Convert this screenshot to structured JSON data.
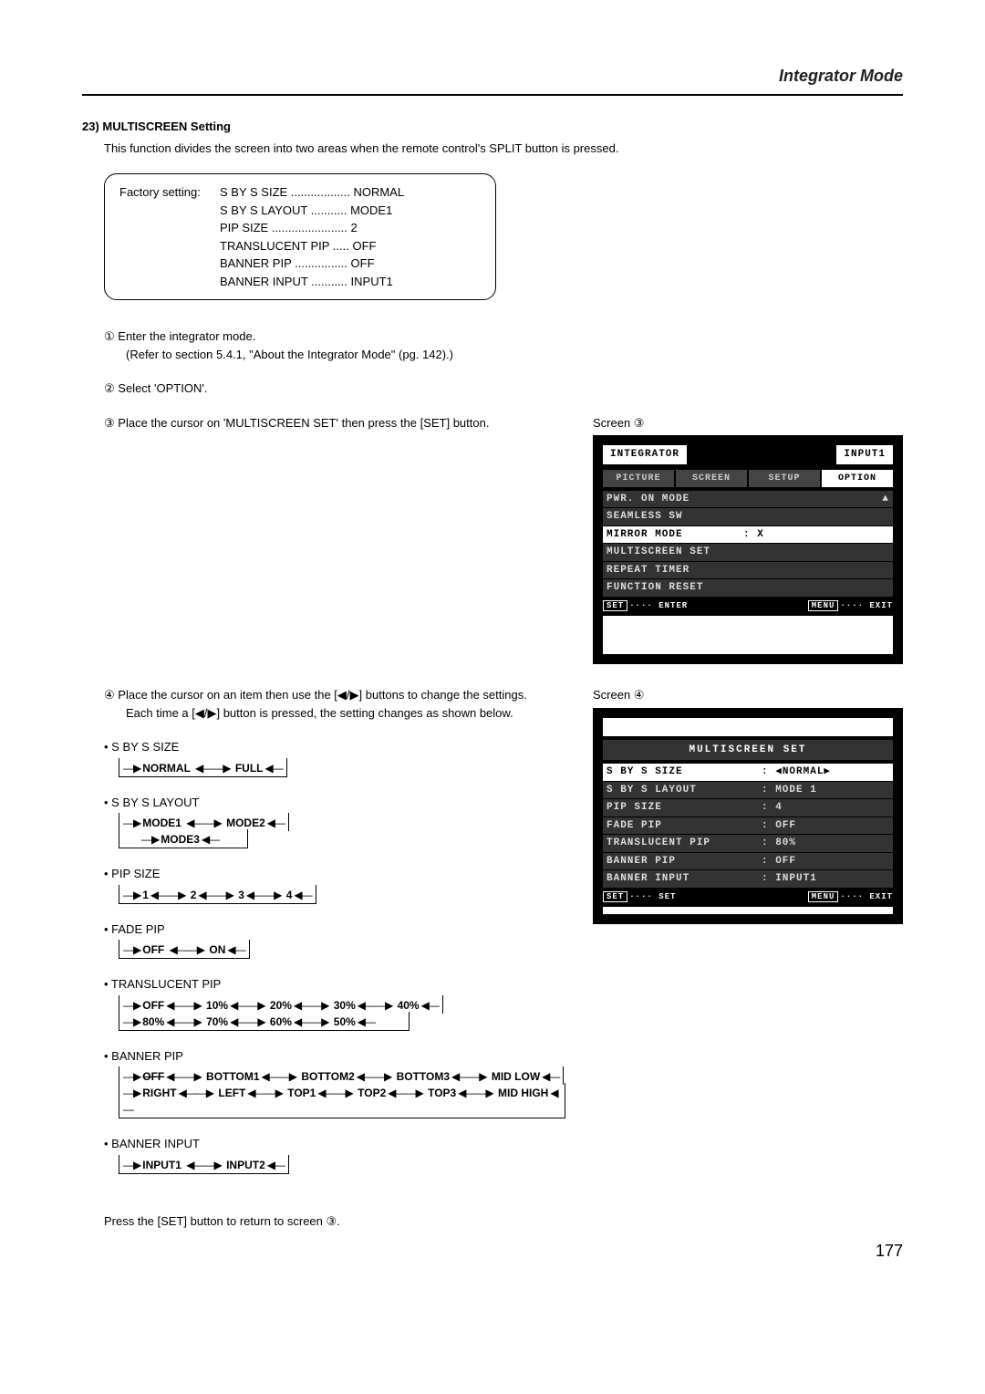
{
  "header": {
    "title": "Integrator Mode"
  },
  "section": {
    "heading": "23) MULTISCREEN Setting",
    "intro": "This function divides the screen into two areas when the remote control's SPLIT button is pressed."
  },
  "factory": {
    "label": "Factory setting:",
    "items": [
      {
        "name": "S BY S SIZE ..................",
        "value": "NORMAL"
      },
      {
        "name": "S BY S LAYOUT ...........",
        "value": "MODE1"
      },
      {
        "name": "PIP SIZE .......................",
        "value": "2"
      },
      {
        "name": "TRANSLUCENT PIP .....",
        "value": "OFF"
      },
      {
        "name": "BANNER PIP ................",
        "value": "OFF"
      },
      {
        "name": "BANNER INPUT ...........",
        "value": "INPUT1"
      }
    ]
  },
  "steps": {
    "s1": {
      "num": "①",
      "text": "Enter the integrator mode.",
      "sub": "(Refer to section 5.4.1, \"About the Integrator Mode\" (pg. 142).)"
    },
    "s2": {
      "num": "②",
      "text": "Select 'OPTION'."
    },
    "s3": {
      "num": "③",
      "text": "Place the cursor on 'MULTISCREEN SET' then press the [SET] button."
    },
    "s4": {
      "num": "④",
      "text": "Place the cursor on an item then use the [◀/▶] buttons to change the settings.",
      "sub": "Each time a [◀/▶] button is pressed, the setting changes as shown below."
    }
  },
  "screen3": {
    "label": "Screen ③",
    "title_left": "INTEGRATOR",
    "title_right": "INPUT1",
    "tabs": [
      "PICTURE",
      "SCREEN",
      "SETUP",
      "OPTION"
    ],
    "active_tab": 3,
    "lines": [
      {
        "text": "PWR. ON MODE",
        "val": "",
        "sel": false,
        "tri": "▲"
      },
      {
        "text": "SEAMLESS SW",
        "val": "",
        "sel": false
      },
      {
        "text": "MIRROR MODE",
        "val": ":  X",
        "sel": true
      },
      {
        "text": "MULTISCREEN SET",
        "val": "",
        "sel": false
      },
      {
        "text": "REPEAT TIMER",
        "val": "",
        "sel": false
      },
      {
        "text": "FUNCTION RESET",
        "val": "",
        "sel": false
      }
    ],
    "footer_left_key": "SET",
    "footer_left_txt": "···· ENTER",
    "footer_right_key": "MENU",
    "footer_right_txt": "···· EXIT"
  },
  "screen4": {
    "label": "Screen ④",
    "title": "MULTISCREEN SET",
    "rows": [
      {
        "key": "S BY S SIZE",
        "val": ": ◀NORMAL▶",
        "sel": true
      },
      {
        "key": "S BY S LAYOUT",
        "val": ":  MODE 1",
        "sel": false
      },
      {
        "key": "PIP SIZE",
        "val": ":  4",
        "sel": false
      },
      {
        "key": "FADE PIP",
        "val": ":  OFF",
        "sel": false
      },
      {
        "key": "TRANSLUCENT PIP",
        "val": ":  80%",
        "sel": false
      },
      {
        "key": "BANNER PIP",
        "val": ":  OFF",
        "sel": false
      },
      {
        "key": "BANNER INPUT",
        "val": ":  INPUT1",
        "sel": false
      }
    ],
    "footer_left_key": "SET",
    "footer_left_txt": "···· SET",
    "footer_right_key": "MENU",
    "footer_right_txt": "···· EXIT"
  },
  "cycles": {
    "sbys_size": {
      "label": "• S BY S SIZE",
      "vals": [
        "NORMAL",
        "FULL"
      ]
    },
    "sbys_layout": {
      "label": "• S BY S LAYOUT",
      "vals1": [
        "MODE1",
        "MODE2"
      ],
      "vals2": [
        "MODE3"
      ]
    },
    "pip_size": {
      "label": "• PIP SIZE",
      "vals": [
        "1",
        "2",
        "3",
        "4"
      ]
    },
    "fade_pip": {
      "label": "• FADE PIP",
      "vals": [
        "OFF",
        "ON"
      ]
    },
    "translucent": {
      "label": "• TRANSLUCENT PIP",
      "row1": [
        "OFF",
        "10%",
        "20%",
        "30%",
        "40%"
      ],
      "row2": [
        "80%",
        "70%",
        "60%",
        "50%"
      ]
    },
    "banner_pip": {
      "label": "• BANNER PIP",
      "row1": [
        "OFF",
        "BOTTOM1",
        "BOTTOM2",
        "BOTTOM3",
        "MID LOW"
      ],
      "row2": [
        "RIGHT",
        "LEFT",
        "TOP1",
        "TOP2",
        "TOP3",
        "MID HIGH"
      ]
    },
    "banner_input": {
      "label": "• BANNER INPUT",
      "vals": [
        "INPUT1",
        "INPUT2"
      ]
    }
  },
  "press_note": "Press the [SET] button to return to screen ③.",
  "page_num": "177"
}
